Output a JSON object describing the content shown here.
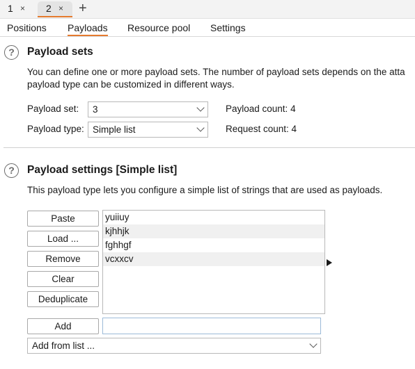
{
  "instance_tabs": [
    {
      "number": "1",
      "close": "×"
    },
    {
      "number": "2",
      "close": "×"
    }
  ],
  "add_tab": "+",
  "sub_tabs": [
    "Positions",
    "Payloads",
    "Resource pool",
    "Settings"
  ],
  "active_sub_tab": "Payloads",
  "accent_color": "#e57a2e",
  "payload_sets": {
    "heading": "Payload sets",
    "description_line1": "You can define one or more payload sets. The number of payload sets depends on the atta",
    "description_line2": "payload type can be customized in different ways.",
    "payload_set_label": "Payload set:",
    "payload_set_value": "3",
    "payload_type_label": "Payload type:",
    "payload_type_value": "Simple list",
    "payload_count": "Payload count: 4",
    "request_count": "Request count: 4"
  },
  "payload_settings": {
    "heading": "Payload settings [Simple list]",
    "description": "This payload type lets you configure a simple list of strings that are used as payloads.",
    "buttons": {
      "paste": "Paste",
      "load": "Load ...",
      "remove": "Remove",
      "clear": "Clear",
      "deduplicate": "Deduplicate",
      "add": "Add"
    },
    "items": [
      "yuiiuy",
      "kjhhjk",
      "fghhgf",
      "vcxxcv"
    ],
    "add_input_value": "",
    "add_from_list": "Add from list ..."
  },
  "help_glyph": "?"
}
